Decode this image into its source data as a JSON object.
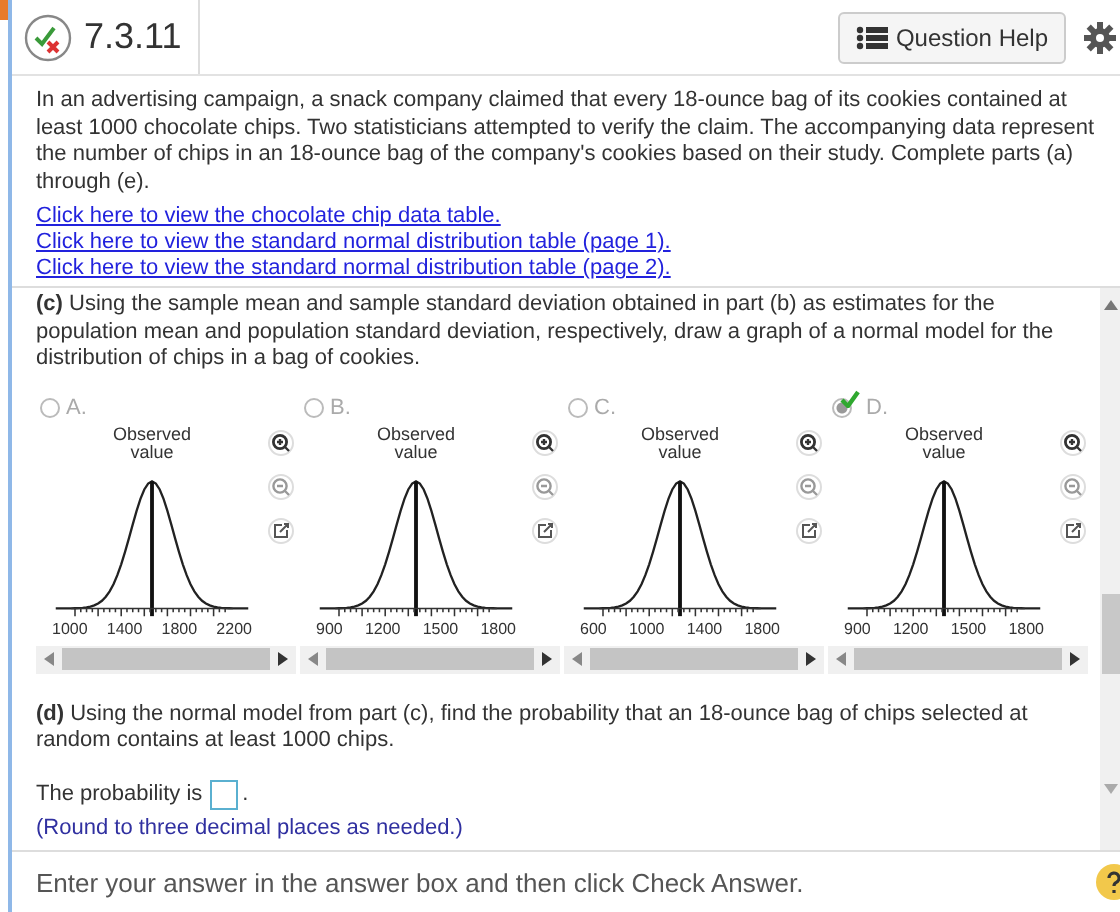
{
  "header": {
    "title": "7.3.11",
    "help_button": "Question Help"
  },
  "intro": "In an advertising campaign, a snack company claimed that every 18-ounce bag of its cookies contained at least 1000 chocolate chips. Two statisticians attempted to verify the claim. The accompanying data represent the number of chips in an 18-ounce bag of the company's cookies based on their study. Complete parts (a) through (e).",
  "links": [
    "Click here to view the chocolate chip data table.",
    "Click here to view the standard normal distribution table (page 1).",
    "Click here to view the standard normal distribution table (page 2)."
  ],
  "part_c": "**(c)** Using the sample mean and sample standard deviation obtained in part (b) as estimates for the population mean and population standard deviation, respectively, draw a graph of a normal model for the distribution of chips in a bag of cookies.",
  "options": [
    {
      "label": "A.",
      "selected": false,
      "correct": false,
      "caption": "Observed value",
      "axis_labels": [
        "1000",
        "1400",
        "1800",
        "2200"
      ]
    },
    {
      "label": "B.",
      "selected": false,
      "correct": false,
      "caption": "Observed value",
      "axis_labels": [
        "900",
        "1200",
        "1500",
        "1800"
      ]
    },
    {
      "label": "C.",
      "selected": false,
      "correct": false,
      "caption": "Observed value",
      "axis_labels": [
        "600",
        "1000",
        "1400",
        "1800"
      ]
    },
    {
      "label": "D.",
      "selected": true,
      "correct": true,
      "caption": "Observed value",
      "axis_labels": [
        "900",
        "1200",
        "1500",
        "1800"
      ]
    }
  ],
  "part_d": "**(d)** Using the normal model from part (c), find the probability that an 18-ounce bag of chips selected at random contains at least 1000 chips.",
  "answer": {
    "prefix": "The probability is",
    "suffix": ".",
    "hint": "(Round to three decimal places as needed.)"
  },
  "footer": "Enter your answer in the answer box and then click Check Answer."
}
